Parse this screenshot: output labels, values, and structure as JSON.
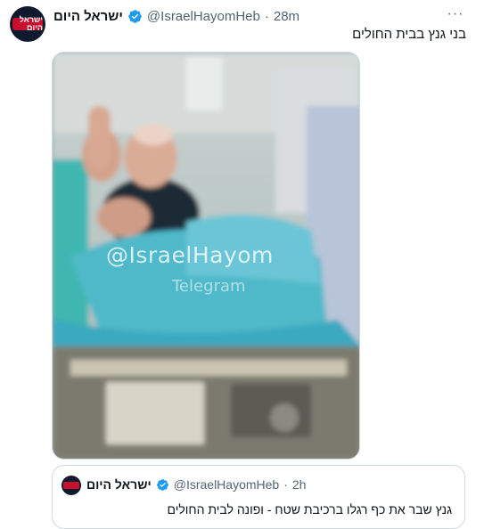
{
  "tweet": {
    "author_name": "ישראל היום",
    "handle": "@IsraelHayomHeb",
    "separator": "·",
    "time": "28m",
    "more_label": "···",
    "text": "בני גנץ בבית החולים",
    "avatar_label": "ישראל היום"
  },
  "media": {
    "watermark": "@IsraelHayom",
    "watermark_sub": "Telegram"
  },
  "quoted_tweet": {
    "author_name": "ישראל היום",
    "handle": "@IsraelHayomHeb",
    "separator": "·",
    "time": "2h",
    "text": "גנץ שבר את כף רגלו ברכיבת שטח - ופונה לבית החולים"
  },
  "colors": {
    "verified": "#1d9bf0",
    "brand_red": "#c8102e",
    "secondary_text": "#536471"
  },
  "icons": {
    "verified": "verified-badge-icon",
    "more": "more-options-icon"
  }
}
